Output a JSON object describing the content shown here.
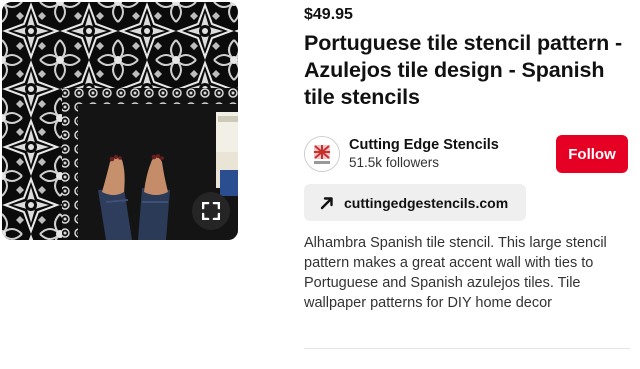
{
  "pin": {
    "image_alt": "Black and white Portuguese tile stencil floor with feet",
    "expand_icon": "expand-icon"
  },
  "details": {
    "price": "$49.95",
    "title": "Portuguese tile stencil pattern - Azulejos tile design - Spanish tile stencils",
    "creator": {
      "name": "Cutting Edge Stencils",
      "followers": "51.5k followers",
      "follow_label": "Follow",
      "avatar_icon": "brand-logo-icon"
    },
    "link": {
      "icon": "arrow-up-right-icon",
      "text": "cuttingedgestencils.com"
    },
    "description": "Alhambra Spanish tile stencil. This large stencil pattern makes a great accent wall with ties to Portuguese and Spanish azulejos tiles. Tile wallpaper patterns for DIY home decor"
  },
  "colors": {
    "accent": "#e60023",
    "link_button_bg": "#efefef",
    "text": "#111111"
  }
}
